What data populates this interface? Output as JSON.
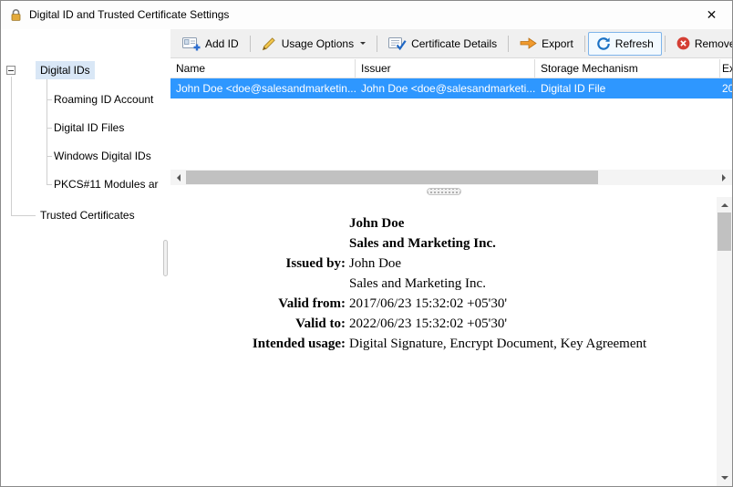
{
  "window": {
    "title": "Digital ID and Trusted Certificate Settings",
    "close_glyph": "✕"
  },
  "sidebar": {
    "items": [
      {
        "label": "Digital IDs"
      },
      {
        "label": "Roaming ID Account"
      },
      {
        "label": "Digital ID Files"
      },
      {
        "label": "Windows Digital IDs"
      },
      {
        "label": "PKCS#11 Modules ar"
      },
      {
        "label": "Trusted Certificates"
      }
    ]
  },
  "toolbar": {
    "buttons": [
      {
        "label": "Add ID"
      },
      {
        "label": "Usage Options"
      },
      {
        "label": "Certificate Details"
      },
      {
        "label": "Export"
      },
      {
        "label": "Refresh"
      },
      {
        "label": "Remove ID"
      }
    ]
  },
  "table": {
    "columns": [
      "Name",
      "Issuer",
      "Storage Mechanism",
      "Ex"
    ],
    "rows": [
      {
        "name": "John Doe <doe@salesandmarketin...",
        "issuer": "John Doe <doe@salesandmarketi...",
        "storage": "Digital ID File",
        "expires": "20"
      }
    ]
  },
  "details": {
    "lines": [
      {
        "label": "",
        "value": "John Doe"
      },
      {
        "label": "",
        "value": "Sales and Marketing Inc."
      },
      {
        "label": "Issued by:",
        "value": "John Doe"
      },
      {
        "label": "",
        "value": "Sales and Marketing Inc."
      },
      {
        "label": "Valid from:",
        "value": "2017/06/23 15:32:02 +05'30'"
      },
      {
        "label": "Valid to:",
        "value": "2022/06/23 15:32:02 +05'30'"
      },
      {
        "label": "Intended usage:",
        "value": "Digital Signature, Encrypt Document, Key Agreement"
      }
    ]
  },
  "colors": {
    "selection_blue": "#2E97FF",
    "toolbar_bg": "#F0F0F0",
    "refresh_button_border": "#7EB4EA",
    "tree_selection_bg": "#D9E7F6"
  }
}
